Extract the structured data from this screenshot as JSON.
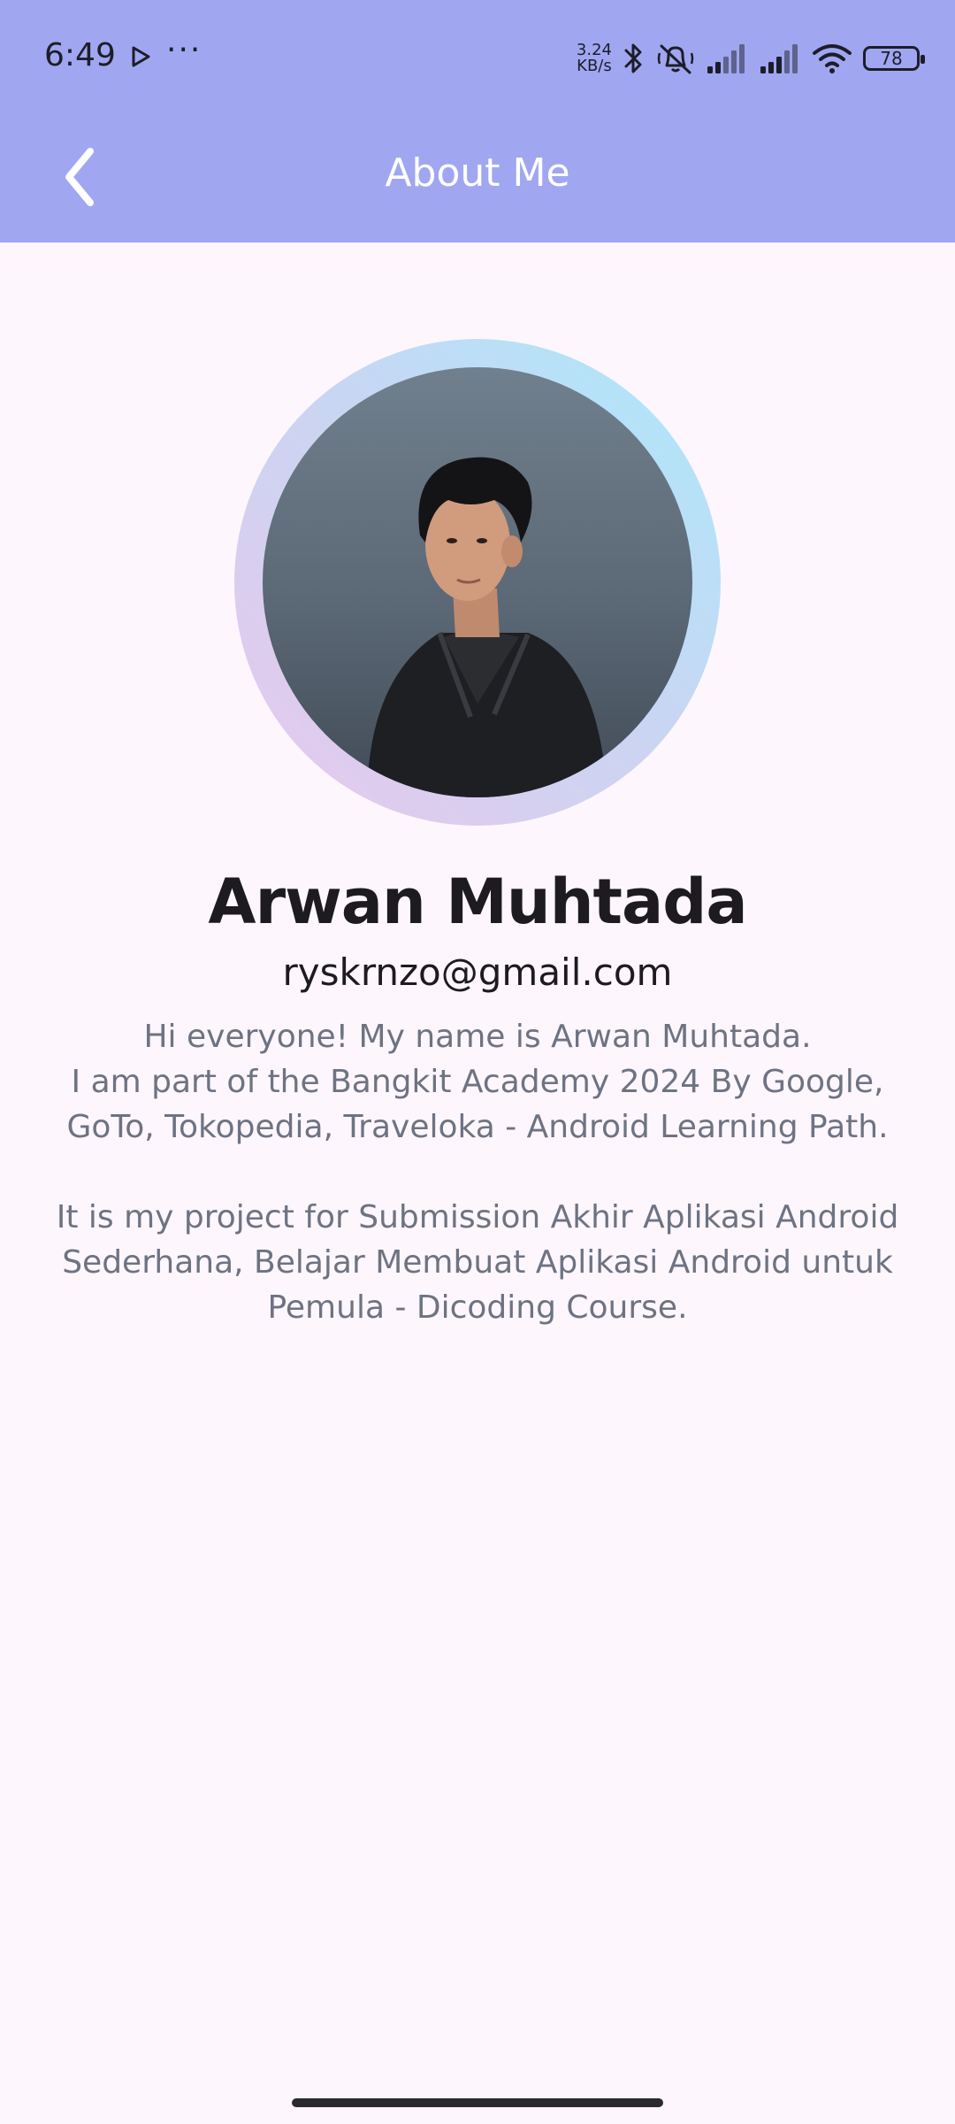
{
  "status_bar": {
    "time": "6:49",
    "more": "···",
    "net_speed_value": "3.24",
    "net_speed_unit": "KB/s",
    "battery_level": "78"
  },
  "toolbar": {
    "title": "About Me"
  },
  "profile": {
    "name": "Arwan Muhtada",
    "email": "ryskrnzo@gmail.com",
    "bio_lines_1": [
      "Hi everyone! My name is Arwan Muhtada.",
      "I am part of the Bangkit Academy 2024 By Google,",
      "GoTo, Tokopedia, Traveloka - Android Learning Path."
    ],
    "bio_lines_2": [
      "It is my project for Submission Akhir Aplikasi Android",
      "Sederhana, Belajar Membuat Aplikasi Android untuk",
      "Pemula - Dicoding Course."
    ]
  },
  "colors": {
    "app_bar": "#a0a7f0",
    "background": "#fdf6fd",
    "name_text": "#1d1b20",
    "bio_text": "#6e7382",
    "ring_gradient_start": "#abe9fb",
    "ring_gradient_end": "#e9c7ec"
  },
  "icons": {
    "back": "arrow-back-icon",
    "play": "play-store-icon",
    "bluetooth": "bluetooth-icon",
    "mute": "vibrate-off-icon",
    "signal_1": "cell-signal-icon",
    "signal_2": "cell-signal-icon",
    "wifi": "wifi-icon",
    "battery": "battery-icon"
  }
}
